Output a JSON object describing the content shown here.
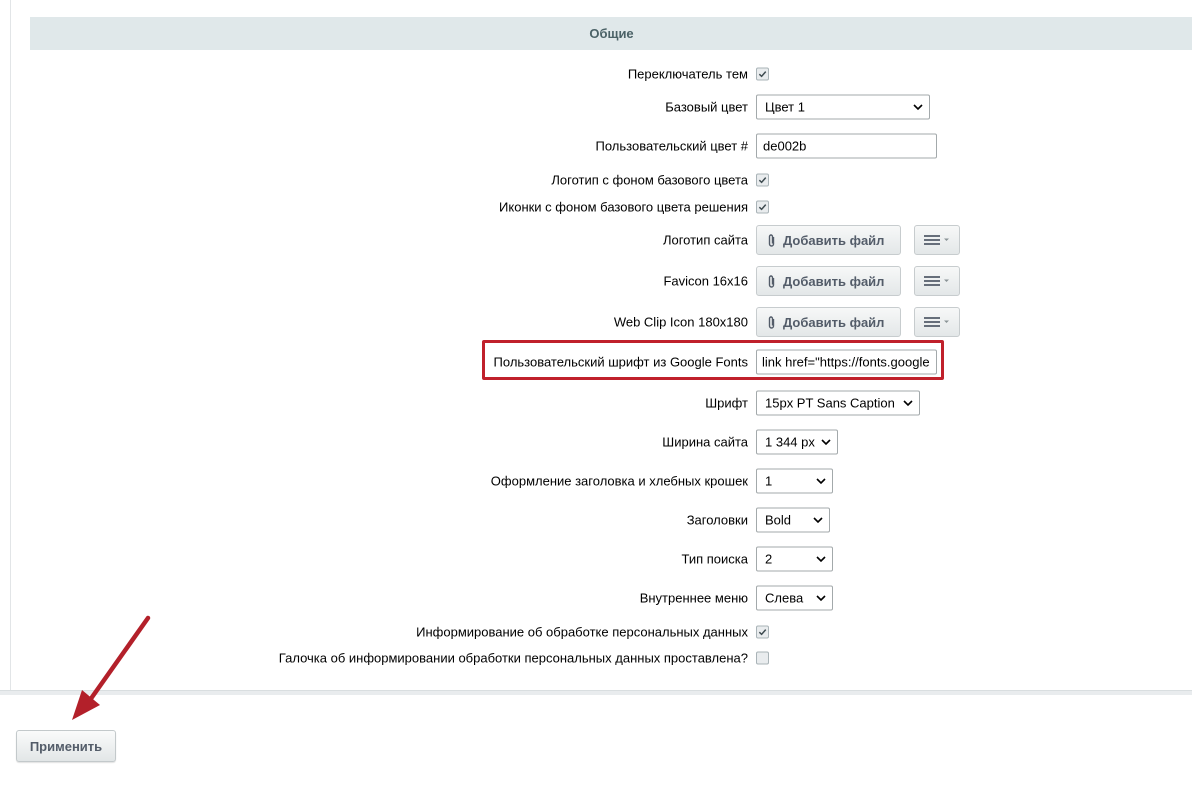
{
  "section": {
    "title": "Общие"
  },
  "rows": {
    "theme_switch": {
      "label": "Переключатель тем",
      "checked": true
    },
    "base_color": {
      "label": "Базовый цвет",
      "value": "Цвет 1"
    },
    "custom_color": {
      "label": "Пользовательский цвет #",
      "value": "de002b"
    },
    "logo_bg": {
      "label": "Логотип с фоном базового цвета",
      "checked": true
    },
    "icons_bg": {
      "label": "Иконки с фоном базового цвета решения",
      "checked": true
    },
    "site_logo": {
      "label": "Логотип сайта",
      "button": "Добавить файл"
    },
    "favicon": {
      "label": "Favicon 16x16",
      "button": "Добавить файл"
    },
    "webclip": {
      "label": "Web Clip Icon 180x180",
      "button": "Добавить файл"
    },
    "google_font": {
      "label": "Пользовательский шрифт из Google Fonts",
      "value": "link href=\"https://fonts.google"
    },
    "font": {
      "label": "Шрифт",
      "value": "15px PT Sans Caption"
    },
    "site_width": {
      "label": "Ширина сайта",
      "value": "1 344 px"
    },
    "title_style": {
      "label": "Оформление заголовка и хлебных крошек",
      "value": "1"
    },
    "headings": {
      "label": "Заголовки",
      "value": "Bold"
    },
    "search_type": {
      "label": "Тип поиска",
      "value": "2"
    },
    "inner_menu": {
      "label": "Внутреннее меню",
      "value": "Слева"
    },
    "pd_inform": {
      "label": "Информирование об обработке персональных данных",
      "checked": true
    },
    "pd_checked": {
      "label": "Галочка об информировании обработки персональных данных проставлена?",
      "checked": false
    }
  },
  "footer": {
    "apply_label": "Применить"
  },
  "colors": {
    "highlight": "#c0202b",
    "section_bg": "#e0e8ea",
    "section_text": "#4b6267"
  },
  "icons": {
    "file_button": "paperclip-icon",
    "menu_button": "hamburger-menu-icon",
    "select": "chevron-down-icon",
    "checkbox": "checkmark-icon",
    "annotation": "red-arrow"
  }
}
